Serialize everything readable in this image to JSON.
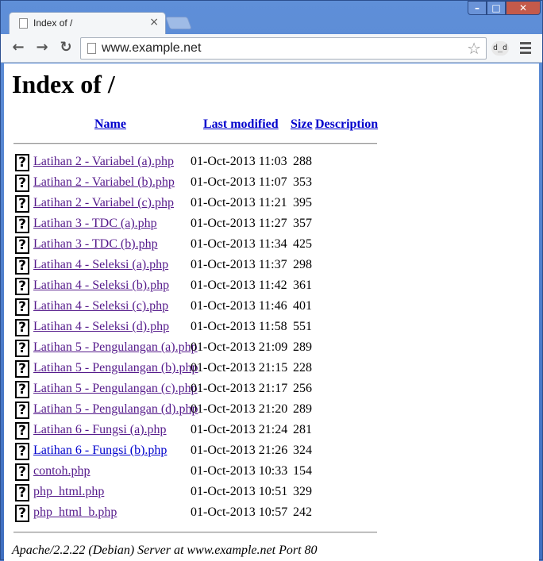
{
  "browser": {
    "tab_title": "Index of /",
    "tab_close": "×",
    "url": "www.example.net",
    "back_icon": "←",
    "forward_icon": "→",
    "reload_icon": "↻",
    "star_icon": "☆",
    "extension_label": "d_d",
    "window_min": "–",
    "window_max": "□",
    "window_close": "✕"
  },
  "page": {
    "title": "Index of /",
    "columns": {
      "name": "Name",
      "last_modified": "Last modified",
      "size": "Size",
      "description": "Description"
    },
    "file_icon": "?",
    "files": [
      {
        "name": "Latihan 2 - Variabel (a).php",
        "date": "01-Oct-2013 11:03",
        "size": "288",
        "visited": true
      },
      {
        "name": "Latihan 2 - Variabel (b).php",
        "date": "01-Oct-2013 11:07",
        "size": "353",
        "visited": true
      },
      {
        "name": "Latihan 2 - Variabel (c).php",
        "date": "01-Oct-2013 11:21",
        "size": "395",
        "visited": true
      },
      {
        "name": "Latihan 3 - TDC (a).php",
        "date": "01-Oct-2013 11:27",
        "size": "357",
        "visited": true
      },
      {
        "name": "Latihan 3 - TDC (b).php",
        "date": "01-Oct-2013 11:34",
        "size": "425",
        "visited": true
      },
      {
        "name": "Latihan 4 - Seleksi (a).php",
        "date": "01-Oct-2013 11:37",
        "size": "298",
        "visited": true
      },
      {
        "name": "Latihan 4 - Seleksi (b).php",
        "date": "01-Oct-2013 11:42",
        "size": "361",
        "visited": true
      },
      {
        "name": "Latihan 4 - Seleksi (c).php",
        "date": "01-Oct-2013 11:46",
        "size": "401",
        "visited": true
      },
      {
        "name": "Latihan 4 - Seleksi (d).php",
        "date": "01-Oct-2013 11:58",
        "size": "551",
        "visited": true
      },
      {
        "name": "Latihan 5 - Pengulangan (a).php",
        "date": "01-Oct-2013 21:09",
        "size": "289",
        "visited": true
      },
      {
        "name": "Latihan 5 - Pengulangan (b).php",
        "date": "01-Oct-2013 21:15",
        "size": "228",
        "visited": true
      },
      {
        "name": "Latihan 5 - Pengulangan (c).php",
        "date": "01-Oct-2013 21:17",
        "size": "256",
        "visited": true
      },
      {
        "name": "Latihan 5 - Pengulangan (d).php",
        "date": "01-Oct-2013 21:20",
        "size": "289",
        "visited": true
      },
      {
        "name": "Latihan 6 - Fungsi (a).php",
        "date": "01-Oct-2013 21:24",
        "size": "281",
        "visited": true
      },
      {
        "name": "Latihan 6 - Fungsi (b).php",
        "date": "01-Oct-2013 21:26",
        "size": "324",
        "visited": false
      },
      {
        "name": "contoh.php",
        "date": "01-Oct-2013 10:33",
        "size": "154",
        "visited": true
      },
      {
        "name": "php_html.php",
        "date": "01-Oct-2013 10:51",
        "size": "329",
        "visited": true
      },
      {
        "name": "php_html_b.php",
        "date": "01-Oct-2013 10:57",
        "size": "242",
        "visited": true
      }
    ],
    "footer": "Apache/2.2.22 (Debian) Server at www.example.net Port 80"
  }
}
